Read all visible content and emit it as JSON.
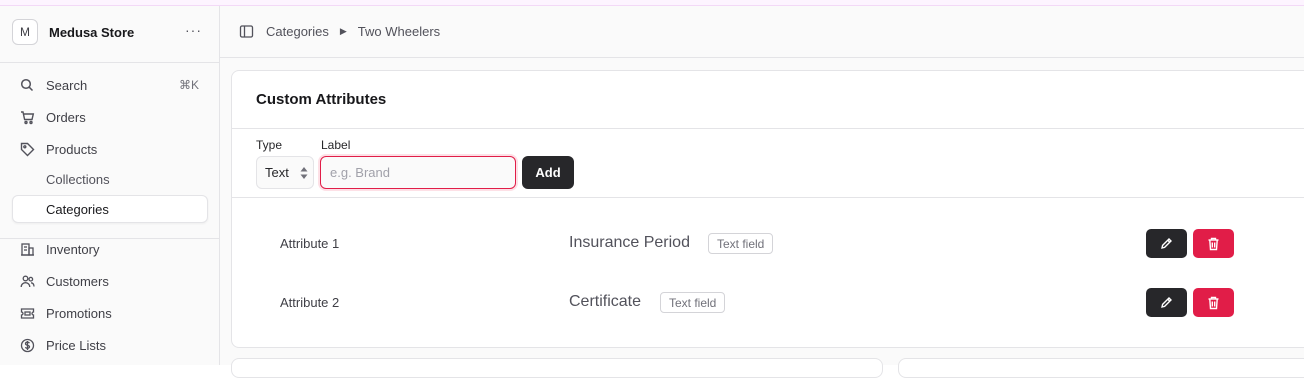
{
  "sidebar": {
    "store": {
      "initial": "M",
      "name": "Medusa Store",
      "more": "···"
    },
    "search": {
      "label": "Search",
      "shortcut": "⌘K",
      "icon": "search-icon"
    },
    "items": [
      {
        "label": "Orders",
        "icon": "cart-icon"
      },
      {
        "label": "Products",
        "icon": "tag-icon"
      },
      {
        "label": "Collections",
        "sub": true
      },
      {
        "label": "Categories",
        "sub": true,
        "active": true
      },
      {
        "label": "Inventory",
        "icon": "building-icon"
      },
      {
        "label": "Customers",
        "icon": "users-icon"
      },
      {
        "label": "Promotions",
        "icon": "ticket-icon"
      },
      {
        "label": "Price Lists",
        "icon": "dollar-icon"
      }
    ]
  },
  "breadcrumb": [
    "Categories",
    "Two Wheelers"
  ],
  "card": {
    "title": "Custom Attributes",
    "form": {
      "type_label": "Type",
      "type_value": "Text",
      "label_label": "Label",
      "label_placeholder": "e.g. Brand",
      "label_value": "",
      "add_label": "Add"
    },
    "attributes": [
      {
        "name": "Attribute 1",
        "label": "Insurance Period",
        "type": "Text field"
      },
      {
        "name": "Attribute 2",
        "label": "Certificate",
        "type": "Text field"
      }
    ]
  },
  "colors": {
    "accent": "#e11d48",
    "dark": "#27272a"
  }
}
